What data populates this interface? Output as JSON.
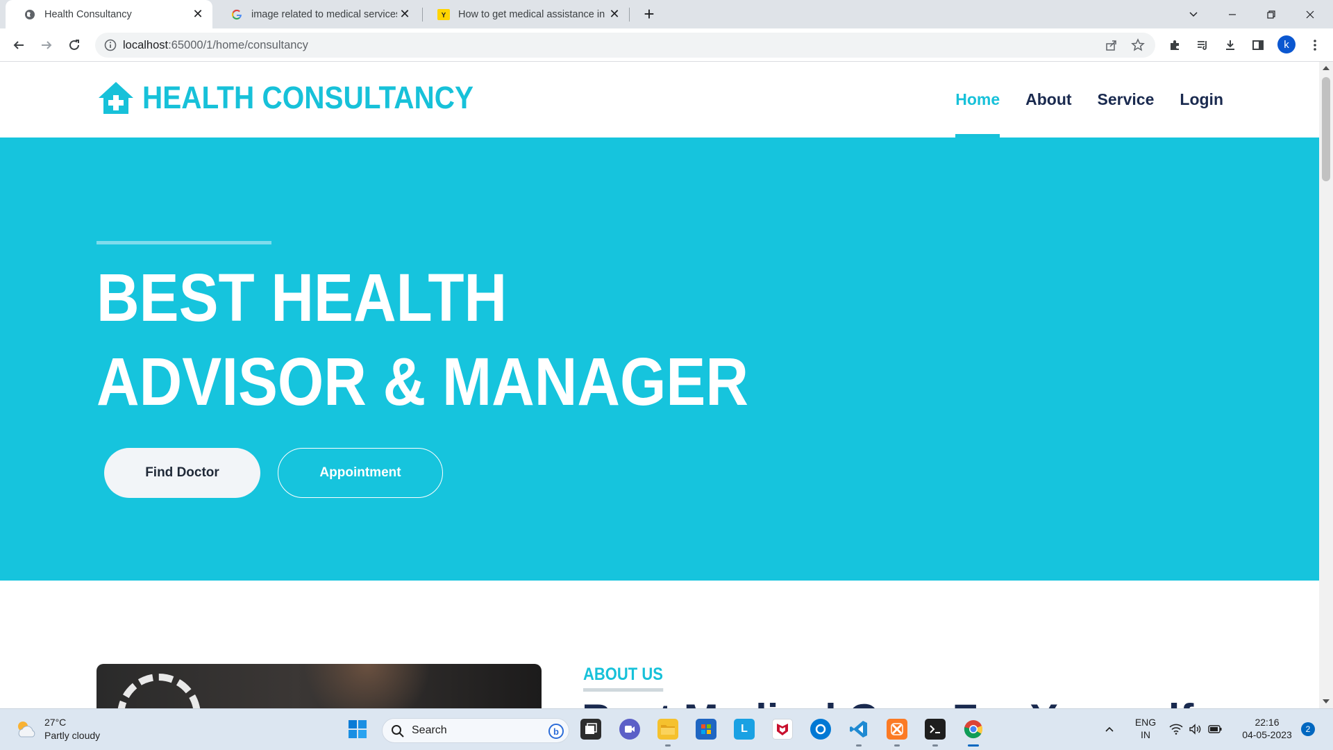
{
  "browser": {
    "tabs": [
      {
        "title": "Health Consultancy",
        "icon": "globe-icon",
        "active": true
      },
      {
        "title": "image related to medical services",
        "icon": "google-icon",
        "active": false
      },
      {
        "title": "How to get medical assistance in",
        "icon": "yellow-site-icon",
        "active": false
      }
    ],
    "close_glyph": "✕",
    "new_tab_glyph": "+",
    "url_host": "localhost",
    "url_path": ":65000/1/home/consultancy",
    "profile_initial": "k"
  },
  "site": {
    "brand": "HEALTH CONSULTANCY",
    "brand_color": "#17c1d9",
    "nav": [
      "Home",
      "About",
      "Service",
      "Login"
    ],
    "active_nav": "Home",
    "hero": {
      "title": "BEST HEALTH ADVISOR & MANAGER",
      "primary_button": "Find Doctor",
      "secondary_button": "Appointment",
      "background": "#16c4dd"
    },
    "about": {
      "label": "ABOUT US",
      "heading": "Best Medical Care For Yourself"
    }
  },
  "taskbar": {
    "temperature": "27°C",
    "weather": "Partly cloudy",
    "search_label": "Search",
    "language_top": "ENG",
    "language_bottom": "IN",
    "time": "22:16",
    "date": "04-05-2023",
    "notifications": "2"
  }
}
